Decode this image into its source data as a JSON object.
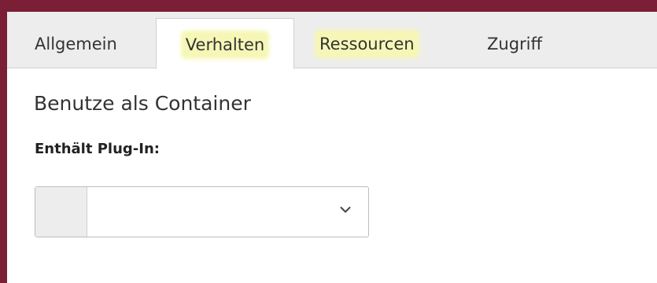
{
  "tabs": [
    {
      "label": "Allgemein"
    },
    {
      "label": "Verhalten"
    },
    {
      "label": "Ressourcen"
    },
    {
      "label": "Zugriff"
    }
  ],
  "section": {
    "title": "Benutze als Container"
  },
  "plugin_field": {
    "label": "Enthält Plug-In:",
    "selected_value": ""
  },
  "icons": {
    "dropdown": "chevron-down-icon"
  },
  "colors": {
    "frame": "#7a1f35",
    "highlight": "#f6f7b6",
    "tabbar_bg": "#ededed"
  }
}
